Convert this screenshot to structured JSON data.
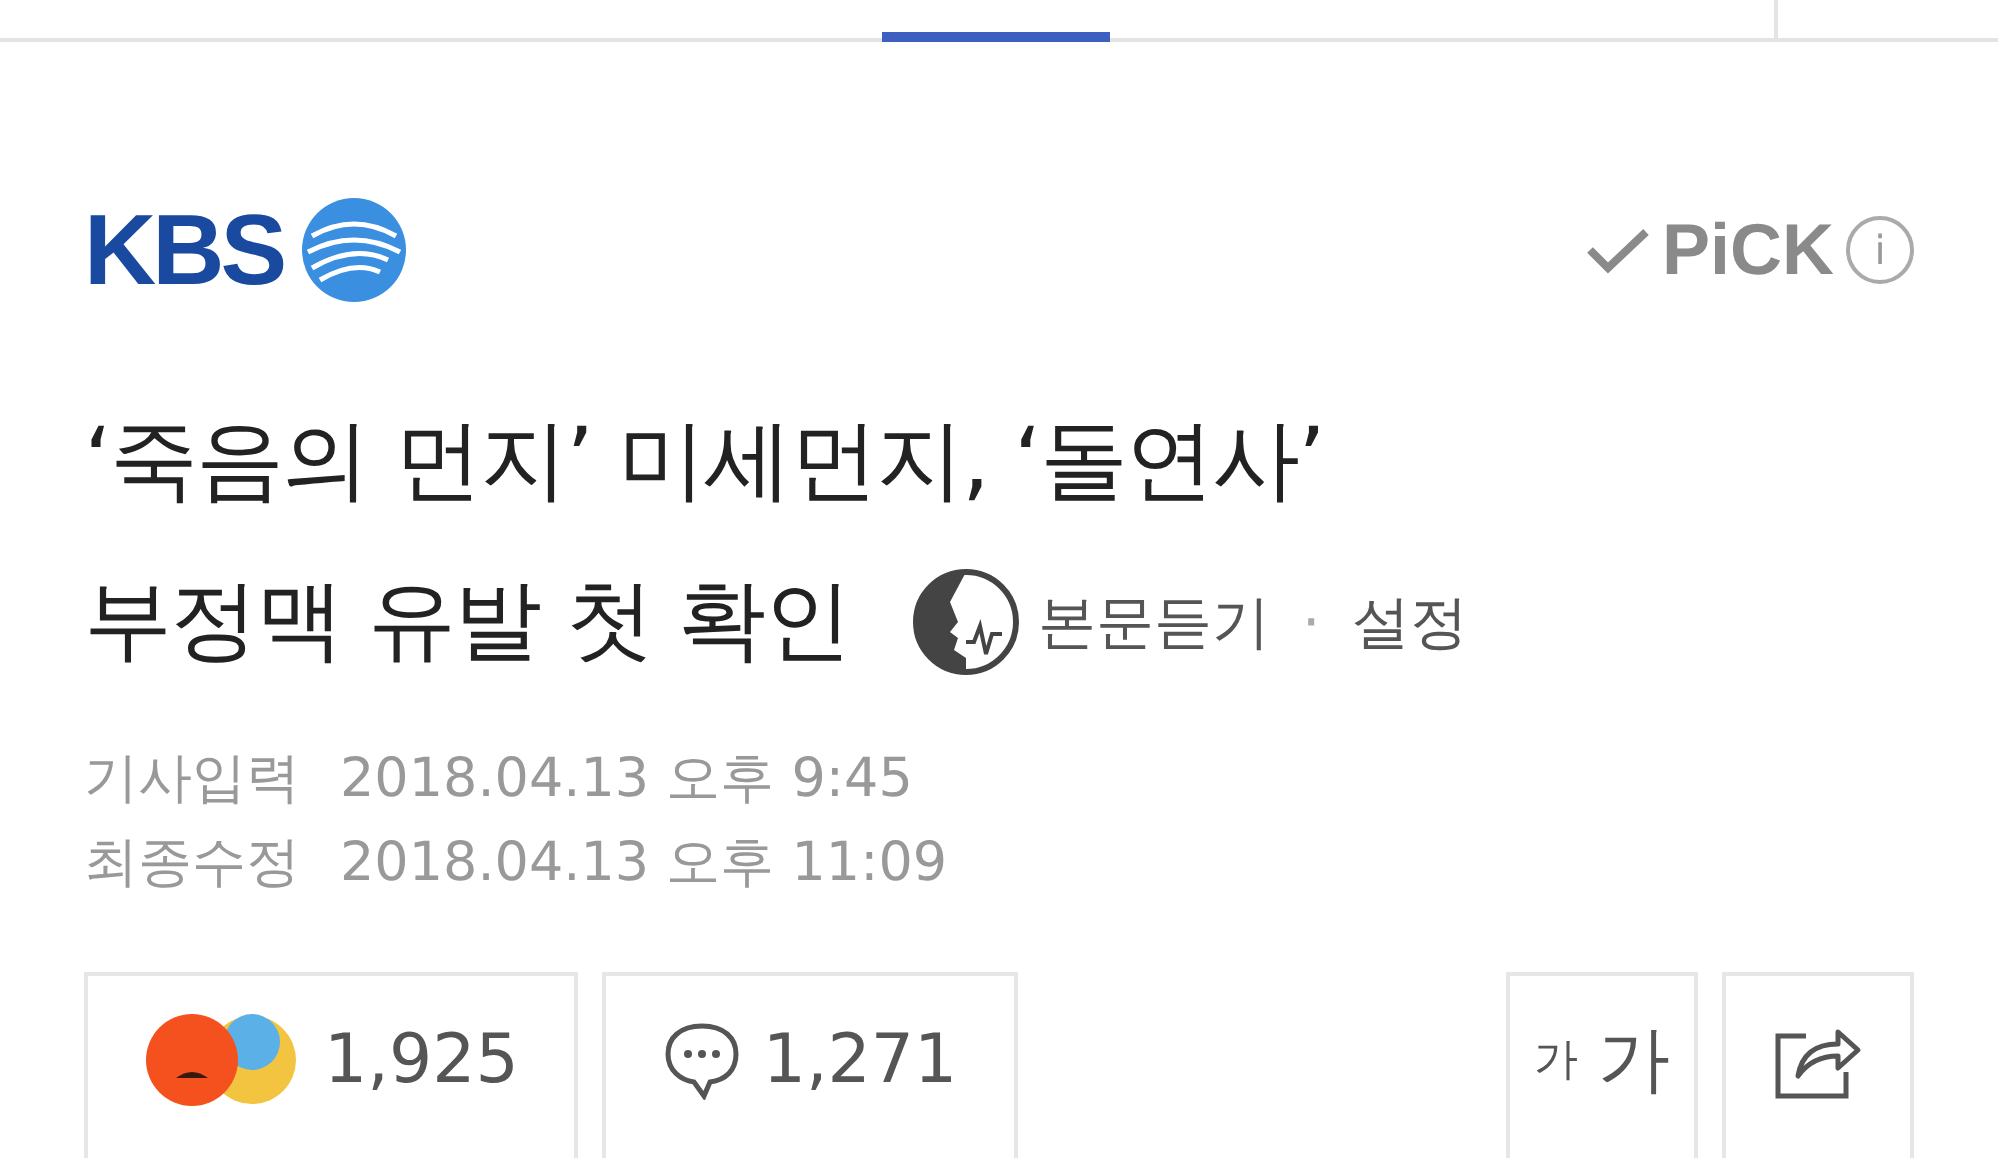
{
  "tab_bar": {
    "tabs": [
      {
        "selected": false
      },
      {
        "selected": true
      },
      {
        "selected": false
      }
    ]
  },
  "publisher": {
    "logo_text": "KBS"
  },
  "pick_badge": {
    "label": "PiCK",
    "info": "i"
  },
  "headline": {
    "lines": [
      "‘죽음의 먼지’ 미세먼지, ‘돌연사’",
      "부정맥 유발 첫 확인"
    ]
  },
  "listen": {
    "label": "본문듣기",
    "separator": "·",
    "settings": "설정"
  },
  "dates": [
    {
      "label": "기사입력",
      "value": "2018.04.13 오후 9:45"
    },
    {
      "label": "최종수정",
      "value": "2018.04.13 오후 11:09"
    }
  ],
  "reactions": {
    "count": "1,925"
  },
  "comments": {
    "count": "1,271"
  },
  "font_size_button": {
    "small": "가",
    "large": "가"
  }
}
